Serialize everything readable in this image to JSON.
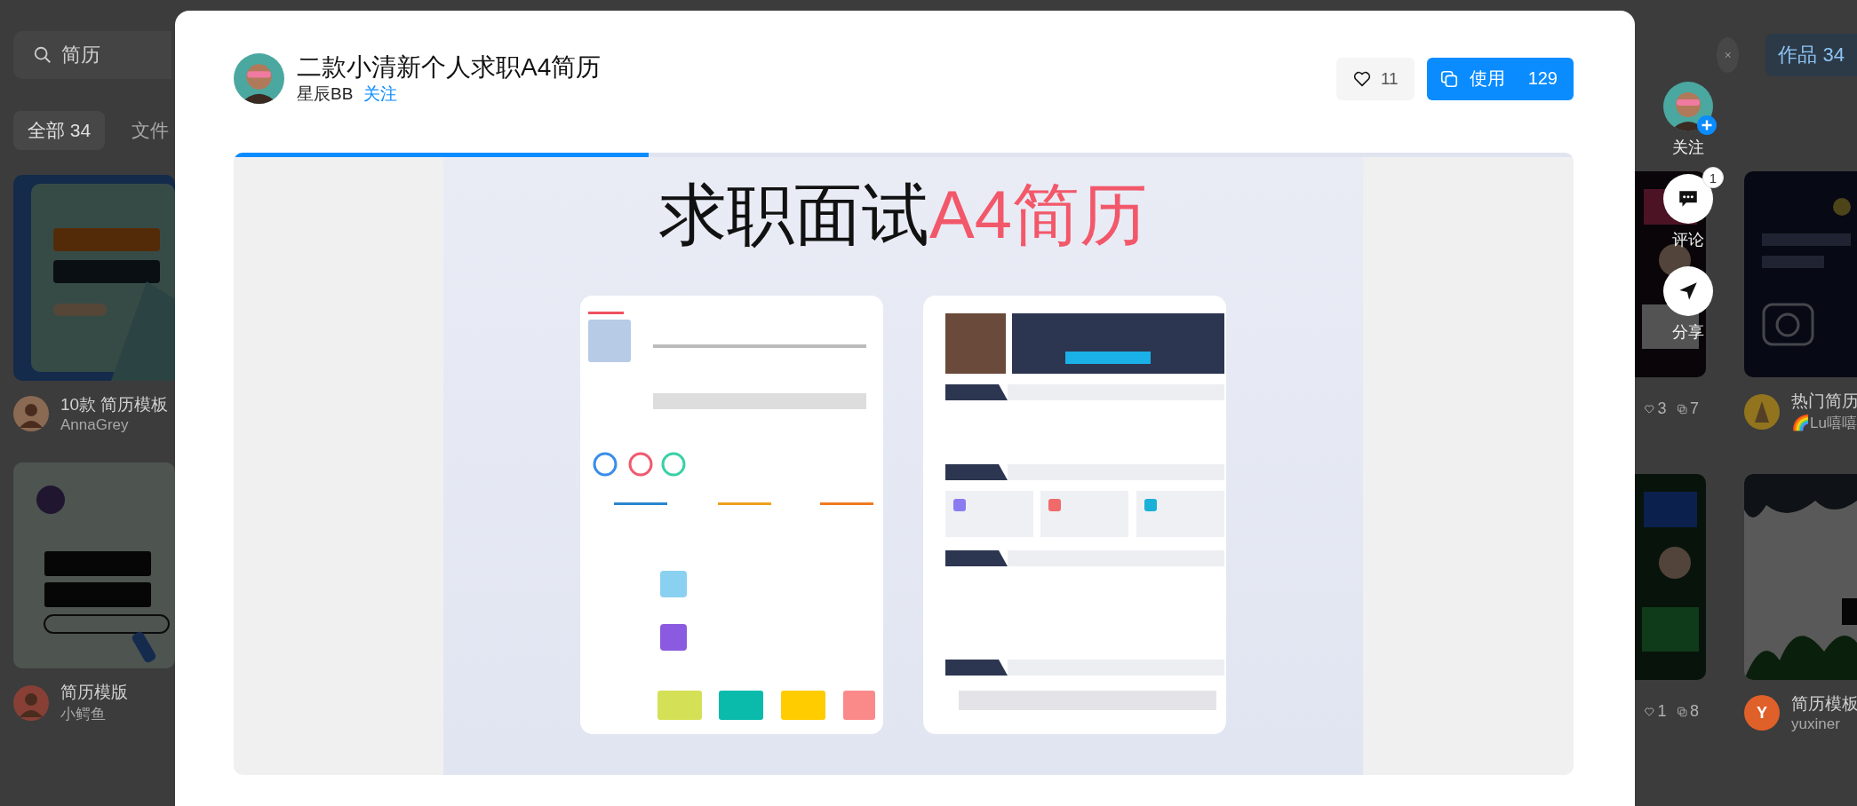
{
  "background": {
    "search": {
      "value": "简历"
    },
    "filters": [
      {
        "label": "全部 34",
        "selected": true
      },
      {
        "label": "文件",
        "selected": false
      }
    ],
    "works_tab": {
      "label": "作品 34"
    },
    "left_cards": [
      {
        "title": "10款 简历模板",
        "author": "AnnaGrey"
      },
      {
        "title": "简历模版",
        "author": "小鳄鱼"
      }
    ],
    "middle_cards": [
      {
        "likes": "3",
        "copies": "7"
      },
      {
        "likes": "1",
        "copies": "8"
      }
    ],
    "right_cards": [
      {
        "title": "热门简历",
        "author": "🌈Lu嘻嘻"
      },
      {
        "title": "简历模板",
        "author": "yuxiner",
        "avatar_letter": "Y"
      }
    ]
  },
  "modal": {
    "title": "二款小清新个人求职A4简历",
    "author": "星辰BB",
    "follow": "关注",
    "likes": "11",
    "use": {
      "label": "使用",
      "count": "129"
    },
    "preview": {
      "level": 0.31,
      "headline": [
        {
          "text": "求职面试",
          "accent": false
        },
        {
          "text": "A4简历",
          "accent": true
        }
      ]
    }
  },
  "side_actions": {
    "follow": {
      "label": "关注"
    },
    "comments": {
      "label": "评论",
      "badge": "1"
    },
    "share": {
      "label": "分享"
    }
  }
}
